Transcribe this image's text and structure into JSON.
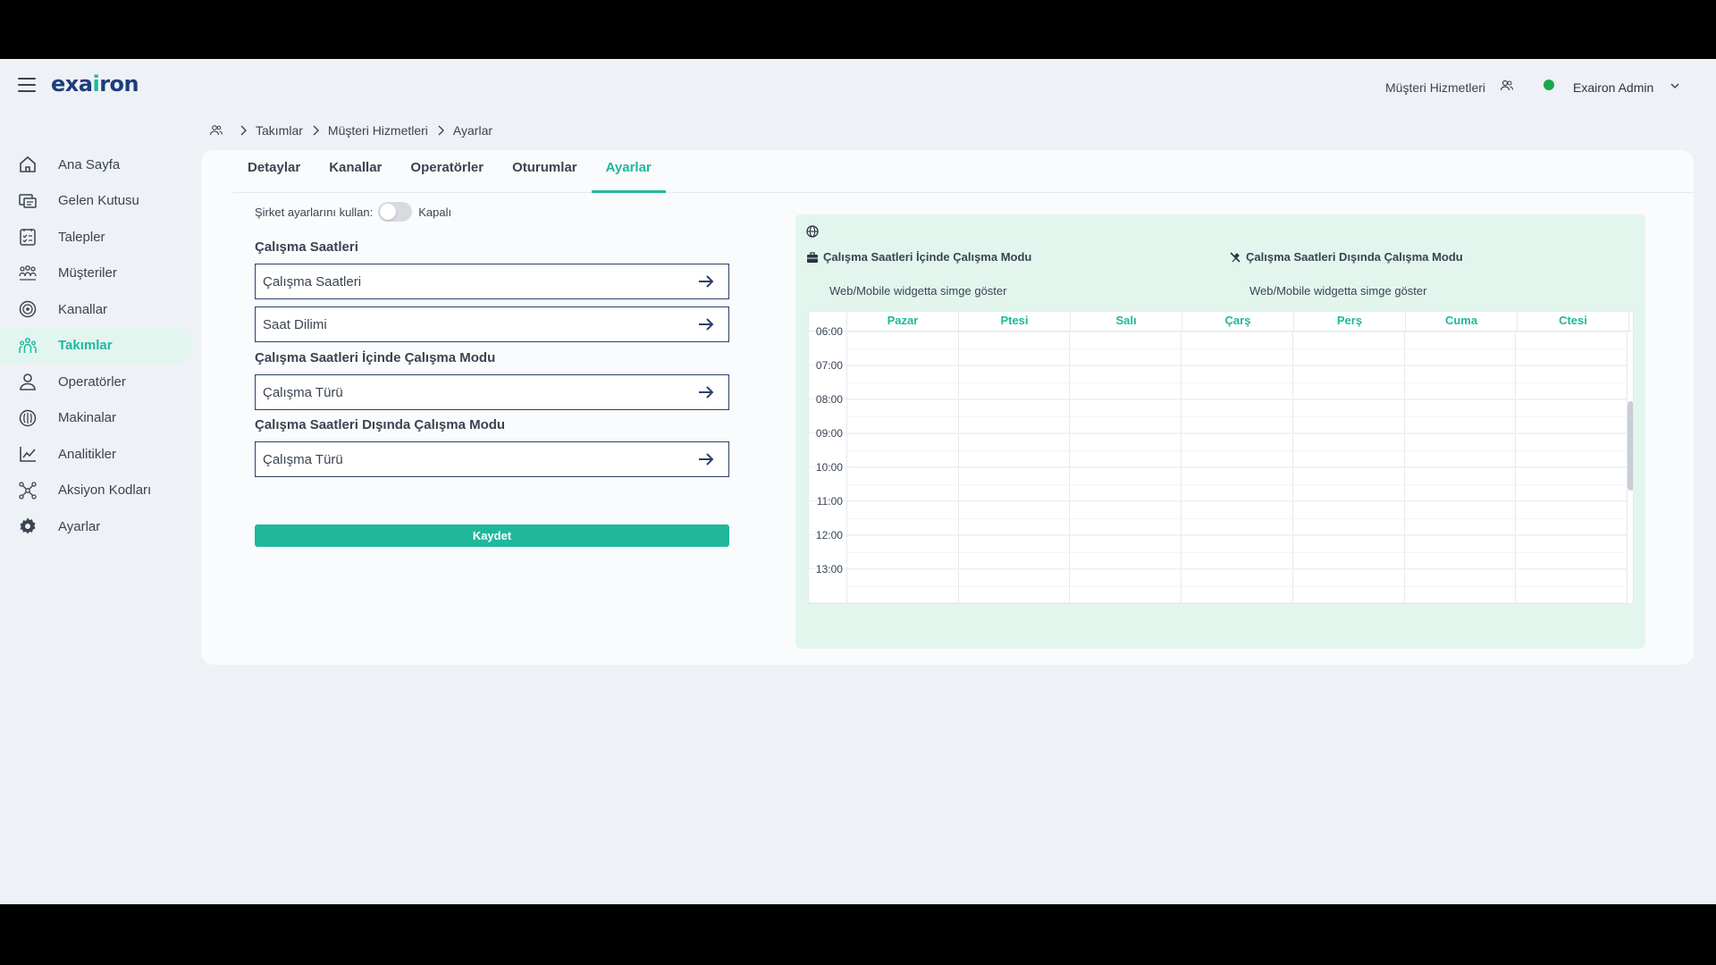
{
  "header": {
    "logo_main": "exa",
    "logo_accent": "i",
    "logo_rest": "ron",
    "team_name": "Müşteri Hizmetleri",
    "user_name": "Exairon Admin"
  },
  "sidebar": {
    "items": [
      {
        "label": "Ana Sayfa",
        "icon": "home-icon"
      },
      {
        "label": "Gelen Kutusu",
        "icon": "inbox-icon"
      },
      {
        "label": "Talepler",
        "icon": "requests-icon"
      },
      {
        "label": "Müşteriler",
        "icon": "customers-icon"
      },
      {
        "label": "Kanallar",
        "icon": "channels-icon"
      },
      {
        "label": "Takımlar",
        "icon": "teams-icon",
        "active": true
      },
      {
        "label": "Operatörler",
        "icon": "operator-icon"
      },
      {
        "label": "Makinalar",
        "icon": "machine-icon"
      },
      {
        "label": "Analitikler",
        "icon": "analytics-icon"
      },
      {
        "label": "Aksiyon Kodları",
        "icon": "action-codes-icon"
      },
      {
        "label": "Ayarlar",
        "icon": "gear-icon"
      }
    ]
  },
  "breadcrumb": [
    "Takımlar",
    "Müşteri Hizmetleri",
    "Ayarlar"
  ],
  "tabs": [
    "Detaylar",
    "Kanallar",
    "Operatörler",
    "Oturumlar",
    "Ayarlar"
  ],
  "active_tab": "Ayarlar",
  "settings": {
    "use_company_label": "Şirket ayarlarını kullan:",
    "toggle_state": "Kapalı",
    "working_hours_title": "Çalışma Saatleri",
    "working_hours_field": "Çalışma Saatleri",
    "timezone_field": "Saat Dilimi",
    "inside_mode_title": "Çalışma Saatleri İçinde Çalışma Modu",
    "inside_mode_field": "Çalışma Türü",
    "outside_mode_title": "Çalışma Saatleri Dışında Çalışma Modu",
    "outside_mode_field": "Çalışma Türü",
    "save_label": "Kaydet"
  },
  "preview": {
    "inside_mode_label": "Çalışma Saatleri İçinde Çalışma Modu",
    "outside_mode_label": "Çalışma Saatleri Dışında Çalışma Modu",
    "inside_widget_text": "Web/Mobile widgetta simge göster",
    "outside_widget_text": "Web/Mobile widgetta simge göster"
  },
  "calendar": {
    "days": [
      "Pazar",
      "Ptesi",
      "Salı",
      "Çarş",
      "Perş",
      "Cuma",
      "Ctesi"
    ],
    "times": [
      "06:00",
      "07:00",
      "08:00",
      "09:00",
      "10:00",
      "11:00",
      "12:00",
      "13:00"
    ]
  },
  "colors": {
    "accent": "#1fb89b",
    "brand": "#1f3d7a",
    "status_online": "#1aa84a"
  }
}
